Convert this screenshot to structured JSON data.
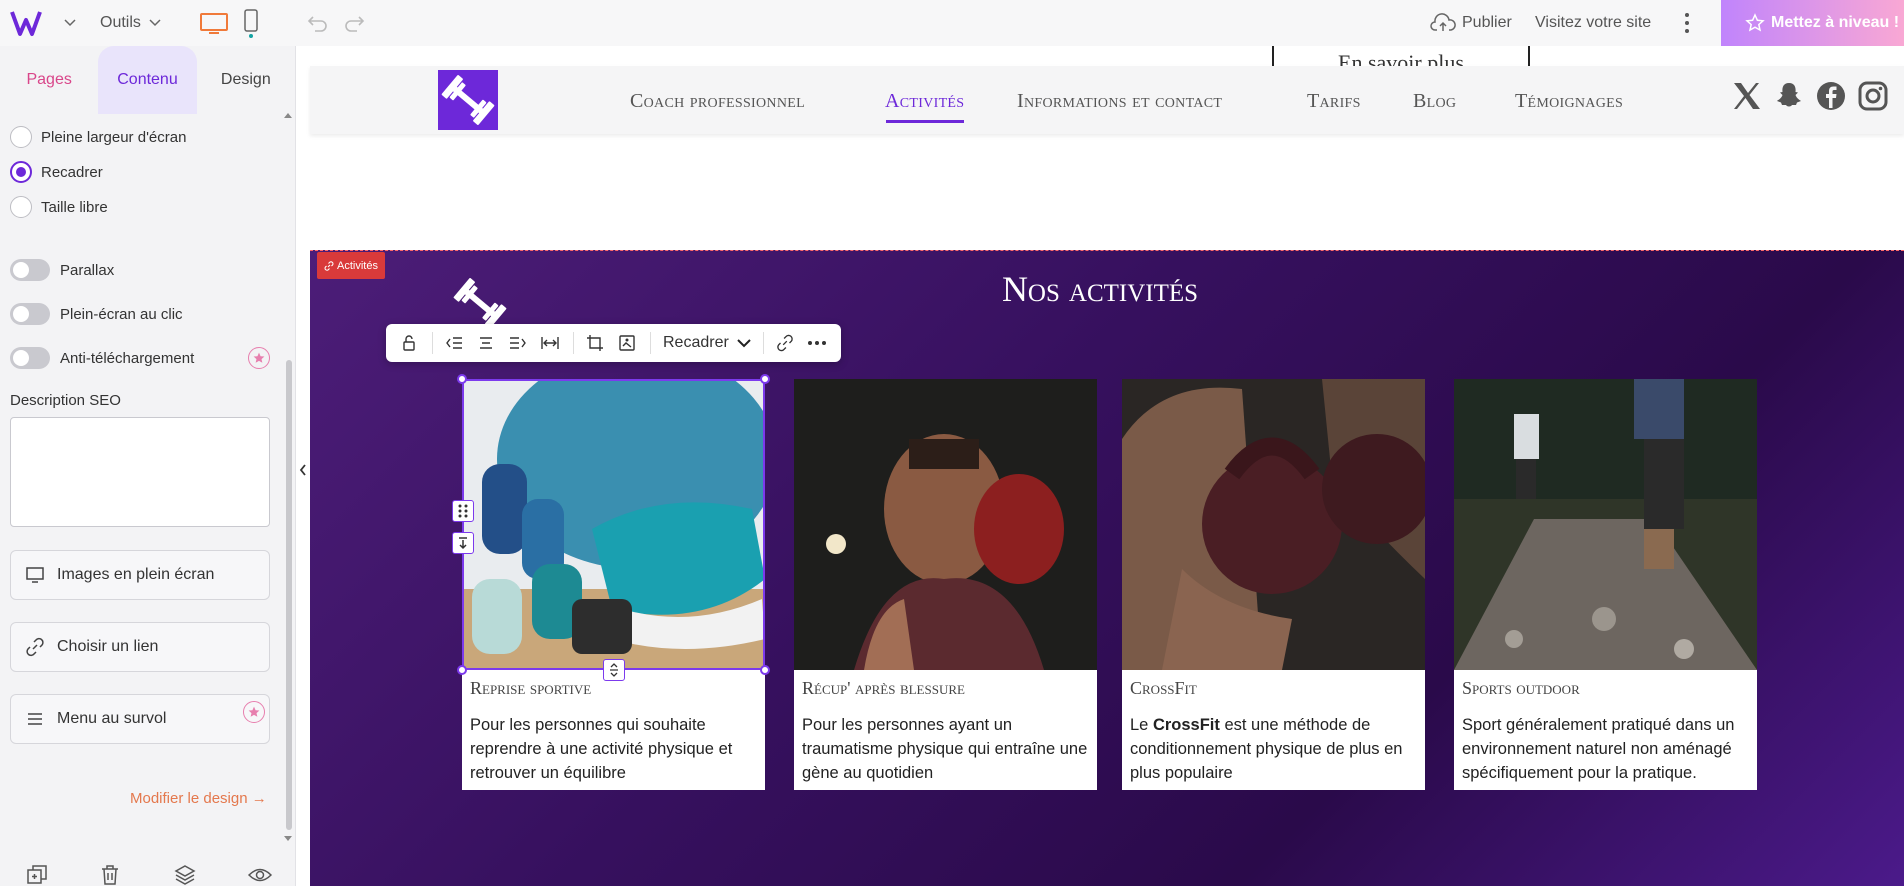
{
  "topbar": {
    "tools_label": "Outils",
    "publish_label": "Publier",
    "visit_label": "Visitez votre site",
    "upgrade_label": "Mettez à niveau !"
  },
  "sidebar": {
    "tabs": [
      {
        "label": "Pages"
      },
      {
        "label": "Contenu"
      },
      {
        "label": "Design"
      }
    ],
    "radio_options": [
      {
        "label": "Pleine largeur d'écran",
        "selected": false
      },
      {
        "label": "Recadrer",
        "selected": true
      },
      {
        "label": "Taille libre",
        "selected": false
      }
    ],
    "toggles": [
      {
        "label": "Parallax",
        "on": false
      },
      {
        "label": "Plein-écran au clic",
        "on": false
      },
      {
        "label": "Anti-téléchargement",
        "on": false
      }
    ],
    "seo_label": "Description SEO",
    "seo_value": "",
    "buttons": {
      "fullscreen_images": "Images en plein écran",
      "choose_link": "Choisir un lien",
      "hover_menu": "Menu au survol"
    },
    "modify_design": "Modifier le design →"
  },
  "site": {
    "savoir_plus": "En savoir plus",
    "nav": [
      {
        "label": "Coach professionnel",
        "active": false
      },
      {
        "label": "Activités",
        "active": true
      },
      {
        "label": "Informations et contact",
        "active": false
      },
      {
        "label": "Tarifs",
        "active": false
      },
      {
        "label": "Blog",
        "active": false
      },
      {
        "label": "Témoignages",
        "active": false
      }
    ],
    "section_tag": "Activités",
    "section_title": "Nos activités",
    "toolbar": {
      "crop_label": "Recadrer"
    },
    "cards": [
      {
        "title": "Reprise sportive",
        "desc": "Pour les personnes qui souhaite reprendre à une activité physique et retrouver un équilibre"
      },
      {
        "title": "Récup' après blessure",
        "desc": "Pour les personnes ayant un traumatisme physique qui entraîne une gène au quotidien"
      },
      {
        "title": "CrossFit",
        "desc_prefix": "Le ",
        "desc_bold": "CrossFit",
        "desc_suffix": " est une méthode de conditionnement physique de plus en plus populaire"
      },
      {
        "title": "Sports outdoor",
        "desc": "Sport généralement pratiqué dans un environnement naturel non aménagé spécifiquement pour la pratique."
      }
    ]
  },
  "colors": {
    "accent": "#6d28d9",
    "section_bg": "#3b1266",
    "tag_red": "#d93a3a",
    "link_orange": "#e4784d"
  }
}
